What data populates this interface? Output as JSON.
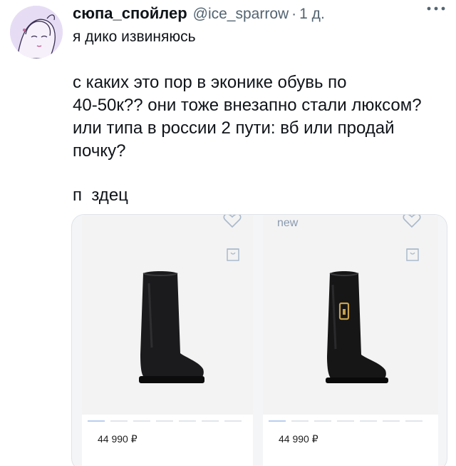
{
  "tweet": {
    "display_name": "сюпа_спойлер",
    "handle": "@ice_sparrow",
    "separator": "·",
    "time": "1 д.",
    "more_icon": "more-horizontal-icon",
    "subtitle": "я дико извиняюсь",
    "body_lines": [
      "с каких это пор в эконике обувь по",
      "40-50к?? они тоже внезапно стали люксом?",
      "или типа в россии 2 пути: вб или продай",
      "почку?"
    ],
    "closing": "п  здец"
  },
  "products": [
    {
      "badge": "",
      "price": "44 990 ₽",
      "icons": [
        "heart-icon",
        "bag-icon"
      ]
    },
    {
      "badge": "new",
      "price": "44 990 ₽",
      "icons": [
        "heart-icon",
        "bag-icon"
      ]
    }
  ],
  "colors": {
    "text": "#0f1419",
    "secondary": "#536471",
    "icon_outline": "#a9b9cc",
    "avatar_bg": "#e6ddf5"
  }
}
